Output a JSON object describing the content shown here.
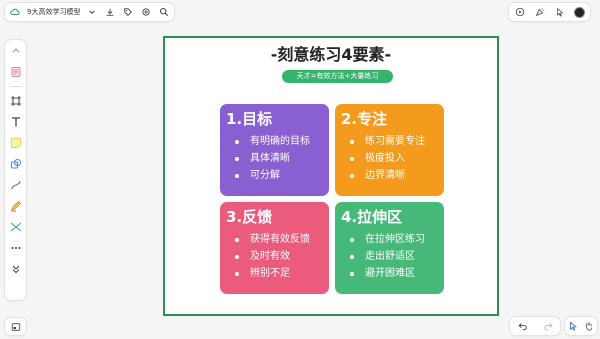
{
  "header": {
    "title": "9大高效学习模型",
    "left_icons": [
      "cloud-icon",
      "chevron-down-icon",
      "download-icon",
      "tag-icon",
      "settings-icon",
      "search-icon"
    ],
    "right_icons": [
      "play-icon",
      "celebrate-icon",
      "pointer-icon",
      "avatar"
    ]
  },
  "toolbar": {
    "icons": [
      "collapse-up-icon",
      "template-icon",
      "frame-icon",
      "text-icon",
      "sticky-note-icon",
      "shape-icon",
      "connector-icon",
      "pen-icon",
      "mindmap-icon",
      "more-icon",
      "expand-down-icon"
    ]
  },
  "canvas": {
    "title": "-刻意练习4要素-",
    "subtitle": "天才=有效方法+大量练习",
    "cards": [
      {
        "heading": "1.目标",
        "color": "#8a5fd2",
        "items": [
          "有明确的目标",
          "具体清晰",
          "可分解"
        ]
      },
      {
        "heading": "2.专注",
        "color": "#f49a1c",
        "items": [
          "练习需要专注",
          "极度投入",
          "边界清晰"
        ]
      },
      {
        "heading": "3.反馈",
        "color": "#ea5b7d",
        "items": [
          "获得有效反馈",
          "及时有效",
          "辨别不足"
        ]
      },
      {
        "heading": "4.拉伸区",
        "color": "#46b878",
        "items": [
          "在拉伸区练习",
          "走出舒适区",
          "避开困难区"
        ]
      }
    ]
  },
  "colors": {
    "frame_border": "#2f8f55",
    "subtitle_bg": "#35b46b"
  }
}
